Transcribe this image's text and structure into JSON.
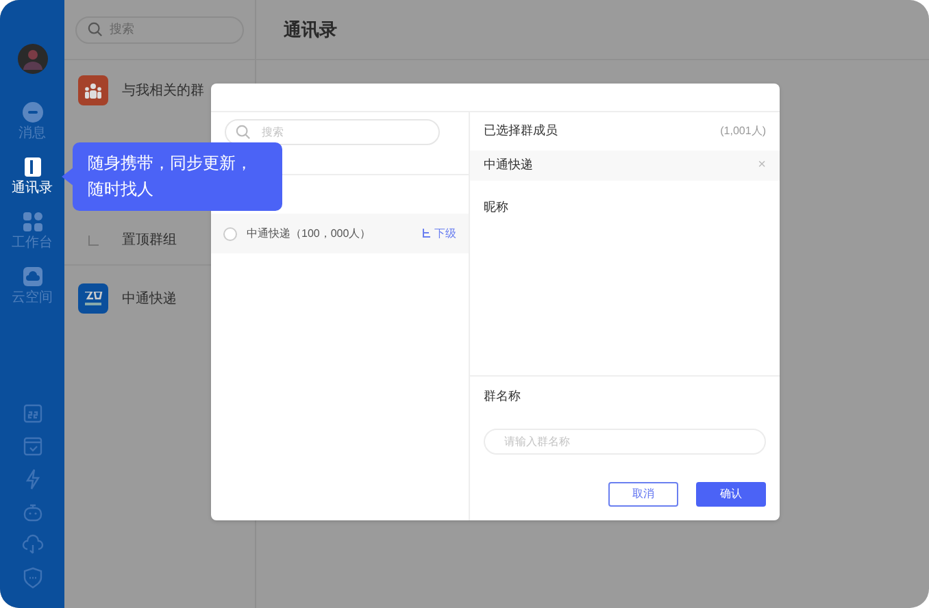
{
  "sidebar": {
    "items": [
      {
        "label": "消息",
        "selected": false
      },
      {
        "label": "通讯录",
        "selected": true
      },
      {
        "label": "工作台",
        "selected": false
      },
      {
        "label": "云空间",
        "selected": false
      }
    ]
  },
  "contacts_panel": {
    "search": {
      "placeholder": "搜索"
    },
    "items": [
      {
        "label": "与我相关的群",
        "kind": "group"
      },
      {
        "label": "置顶群组",
        "kind": "sub"
      },
      {
        "label": "中通快递",
        "kind": "org"
      }
    ]
  },
  "main": {
    "title": "通讯录"
  },
  "tooltip": {
    "text": "随身携带，同步更新，随时找人"
  },
  "dialog": {
    "search": {
      "placeholder": "搜索"
    },
    "org_list": [
      {
        "name": "中通快递（100，000人）",
        "checked": false,
        "action": "下级"
      }
    ],
    "selected_header": {
      "title": "已选择群成员",
      "count": "(1,001人)"
    },
    "selected": [
      {
        "name": "中通快递",
        "remove": "×"
      }
    ],
    "column": "昵称",
    "group_name": {
      "label": "群名称",
      "placeholder": "请输入群名称"
    },
    "buttons": [
      {
        "label": "取消",
        "kind": "secondary"
      },
      {
        "label": "确认",
        "kind": "primary"
      }
    ]
  }
}
